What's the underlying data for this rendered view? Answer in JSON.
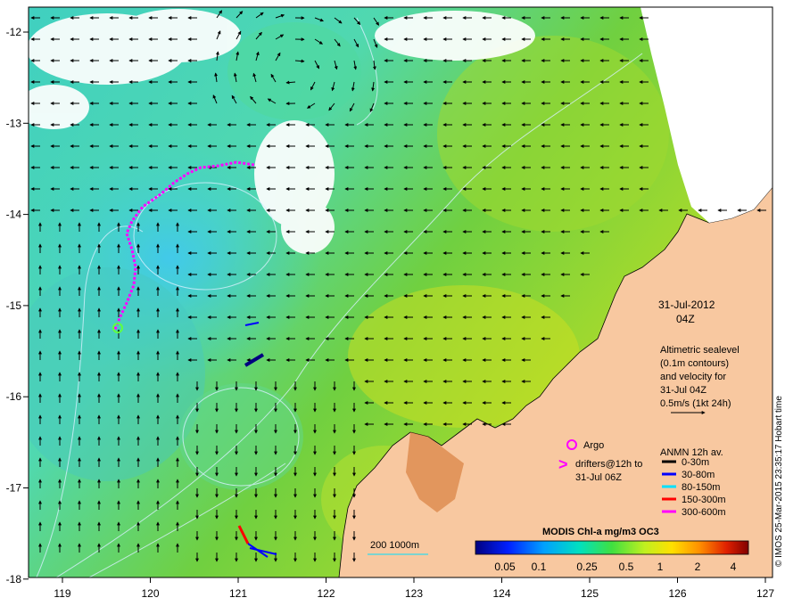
{
  "map": {
    "x_ticks": [
      "119",
      "120",
      "121",
      "122",
      "123",
      "124",
      "125",
      "126",
      "127"
    ],
    "y_ticks": [
      "-12",
      "-13",
      "-14",
      "-15",
      "-16",
      "-17",
      "-18"
    ],
    "colors": {
      "land": "#f8c8a0",
      "cloud": "#ffffff",
      "contour": "#d8f0ff"
    }
  },
  "annotation": {
    "date": "31-Jul-2012",
    "time": "04Z",
    "altimetry_lines": [
      "Altimetric sealevel",
      "(0.1m contours)",
      "and velocity for",
      "31-Jul 04Z",
      "0.5m/s (1kt 24h)"
    ]
  },
  "legend": {
    "argo": "Argo",
    "drifters_line1": "drifters@12h to",
    "drifters_line2": "31-Jul 06Z",
    "anmn_title": "ANMN 12h av.",
    "anmn_items": [
      {
        "label": "0-30m",
        "color": "#000000"
      },
      {
        "label": "30-80m",
        "color": "#0000ff"
      },
      {
        "label": "80-150m",
        "color": "#00e0ff"
      },
      {
        "label": "150-300m",
        "color": "#ff0000"
      },
      {
        "label": "300-600m",
        "color": "#ff00ff"
      }
    ]
  },
  "colorbar": {
    "title": "MODIS Chl-a mg/m3 OC3",
    "tick_labels": [
      "0.05",
      "0.1",
      "0.25",
      "0.5",
      "1",
      "2",
      "4"
    ]
  },
  "depth_legend": {
    "label": "200 1000m"
  },
  "credit": "© IMOS 25-Mar-2015 23:35:17 Hobart time"
}
